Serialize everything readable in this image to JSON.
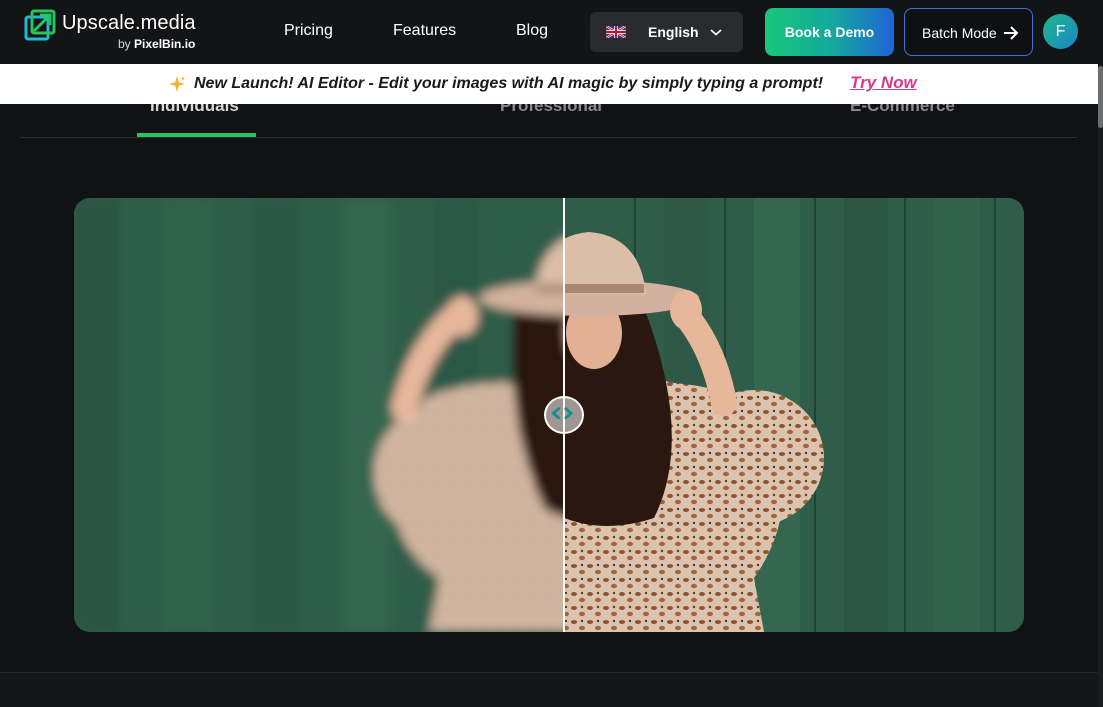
{
  "header": {
    "logo": {
      "name": "Upscale.media",
      "by_prefix": "by ",
      "by_brand": "PixelBin.io",
      "icon": "upscale-arrow-icon"
    },
    "nav": [
      {
        "label": "Pricing"
      },
      {
        "label": "Features"
      },
      {
        "label": "Blog"
      }
    ],
    "language": {
      "selected": "English",
      "flag_icon": "uk-flag-icon",
      "chevron_icon": "chevron-down-icon"
    },
    "book_demo_label": "Book a Demo",
    "batch_mode_label": "Batch Mode",
    "batch_mode_icon": "arrow-right-icon",
    "avatar_initial": "F"
  },
  "banner": {
    "icon": "sparkle-icon",
    "text": "New Launch! AI Editor - Edit your images with AI magic by simply typing a prompt!",
    "cta": "Try Now"
  },
  "tabs": [
    {
      "label": "Individuals",
      "active": true
    },
    {
      "label": "Professional",
      "active": false
    },
    {
      "label": "E-Commerce",
      "active": false
    }
  ],
  "compare": {
    "handle_icon": "compare-handle-icon"
  },
  "colors": {
    "accent_green": "#22c55e",
    "cta_pink": "#d63a8a",
    "demo_gradient_start": "#18c777",
    "demo_gradient_end": "#2064d6",
    "batch_border": "#3f72d8",
    "page_bg": "#111214"
  }
}
